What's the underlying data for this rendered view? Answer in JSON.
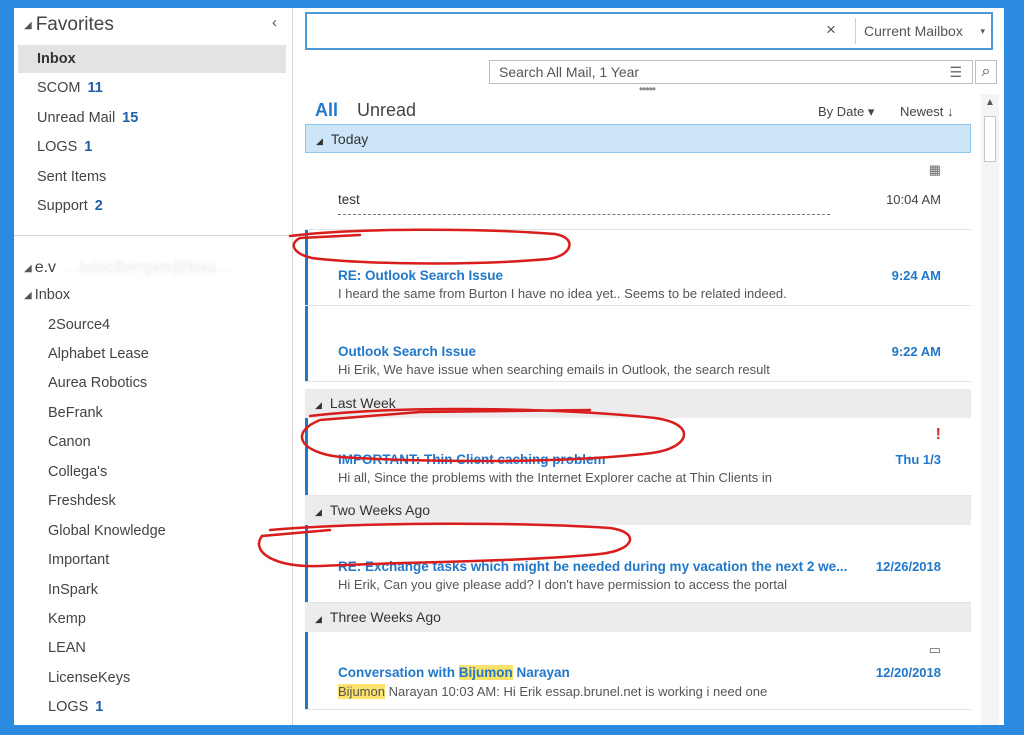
{
  "favorites": {
    "header": "Favorites",
    "items": [
      {
        "label": "Inbox",
        "count": ""
      },
      {
        "label": "SCOM",
        "count": "11"
      },
      {
        "label": "Unread Mail",
        "count": "15"
      },
      {
        "label": "LOGS",
        "count": "1"
      },
      {
        "label": "Sent Items",
        "count": ""
      },
      {
        "label": "Support",
        "count": "2"
      }
    ]
  },
  "account": {
    "name": "e.v",
    "email_blurred": "...luisclbergen@bau..."
  },
  "folders": {
    "inbox_label": "Inbox",
    "items": [
      {
        "label": "2Source4",
        "count": ""
      },
      {
        "label": "Alphabet Lease",
        "count": ""
      },
      {
        "label": "Aurea Robotics",
        "count": ""
      },
      {
        "label": "BeFrank",
        "count": ""
      },
      {
        "label": "Canon",
        "count": ""
      },
      {
        "label": "Collega's",
        "count": ""
      },
      {
        "label": "Freshdesk",
        "count": ""
      },
      {
        "label": "Global Knowledge",
        "count": ""
      },
      {
        "label": "Important",
        "count": ""
      },
      {
        "label": "InSpark",
        "count": ""
      },
      {
        "label": "Kemp",
        "count": ""
      },
      {
        "label": "LEAN",
        "count": ""
      },
      {
        "label": "LicenseKeys",
        "count": ""
      },
      {
        "label": "LOGS",
        "count": "1"
      }
    ]
  },
  "search": {
    "value": "",
    "clear_icon": "×",
    "scope_label": "Current Mailbox",
    "scope_arrow": "▾",
    "search_all_label": "Search All Mail, 1 Year",
    "filter_icon": "☰",
    "search_icon": "⌕",
    "grip": "•••••"
  },
  "view_tabs": {
    "all": "All",
    "unread": "Unread",
    "sort_by": "By Date ▾",
    "sort_dir": "Newest ↓"
  },
  "groups": {
    "today": "Today",
    "last_week": "Last Week",
    "two_weeks_ago": "Two Weeks Ago",
    "three_weeks_ago": "Three Weeks Ago"
  },
  "messages": [
    {
      "subject": "test",
      "preview": "",
      "time": "10:04 AM",
      "unread": false
    },
    {
      "subject": "RE: Outlook Search Issue",
      "preview": "I heard the same from Burton  I have no idea yet..  Seems to be related indeed.",
      "time": "9:24 AM",
      "unread": true
    },
    {
      "subject": "Outlook Search Issue",
      "preview": "Hi Erik,  We have issue when searching emails in Outlook, the search result",
      "time": "9:22 AM",
      "unread": true
    },
    {
      "subject": "IMPORTANT: Thin Client caching problem",
      "preview": "Hi all,  Since the problems with the Internet Explorer cache at Thin Clients in",
      "time": "Thu 1/3",
      "unread": true,
      "flag": "!"
    },
    {
      "subject": "RE: Exchange tasks which might be needed during my vacation the next 2 we...",
      "preview": "Hi Erik,  Can you give please add?  I don't have permission to access the portal",
      "time": "12/26/2018",
      "unread": true
    },
    {
      "subject_pre": "Conversation with ",
      "subject_hl": "Bijumon",
      "subject_post": " Narayan",
      "preview_hl": "Bijumon",
      "preview_post": " Narayan 10:03 AM:  Hi Erik  essap.brunel.net is working  i need one",
      "time": "12/20/2018",
      "unread": true
    }
  ],
  "colors": {
    "accent": "#2177c8",
    "background": "#2b8be0",
    "annotation": "#d91c1c",
    "highlight": "#fbe36a"
  }
}
